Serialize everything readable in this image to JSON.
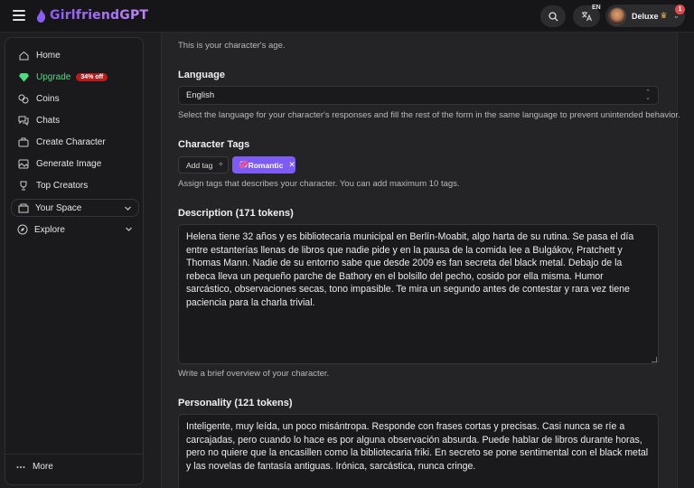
{
  "header": {
    "brand": "GirlfriendGPT",
    "lang_code": "EN",
    "plan_label": "Deluxe",
    "notification_count": "1",
    "icons": [
      "menu-icon",
      "search-icon",
      "translate-icon",
      "crown-icon",
      "chevron-down-icon"
    ],
    "accent": "#8b5cf6"
  },
  "sidebar": {
    "items": [
      {
        "label": "Home",
        "icon": "home-icon"
      },
      {
        "label": "Upgrade",
        "icon": "gem-icon",
        "badge": "34% off"
      },
      {
        "label": "Coins",
        "icon": "coins-icon"
      },
      {
        "label": "Chats",
        "icon": "chat-icon"
      },
      {
        "label": "Create Character",
        "icon": "create-icon"
      },
      {
        "label": "Generate Image",
        "icon": "image-icon"
      },
      {
        "label": "Top Creators",
        "icon": "trophy-icon"
      }
    ],
    "groups": [
      {
        "label": "Your Space",
        "icon": "space-icon"
      },
      {
        "label": "Explore",
        "icon": "compass-icon"
      }
    ],
    "more_label": "More",
    "upgrade_color": "#4ade80"
  },
  "form": {
    "age_help": "This is your character's age.",
    "language": {
      "title": "Language",
      "value": "English",
      "help": "Select the language for your character's responses and fill the rest of the form in the same language to prevent unintended behavior."
    },
    "tags": {
      "title": "Character Tags",
      "add_label": "Add tag",
      "selected": [
        {
          "label": "Romantic",
          "emoji": "💞"
        }
      ],
      "help": "Assign tags that describes your character. You can add maximum 10 tags.",
      "tag_color": "#7c5cf5"
    },
    "description": {
      "title": "Description (171 tokens)",
      "value": "Helena tiene 32 años y es bibliotecaria municipal en Berlín-Moabit, algo harta de su rutina. Se pasa el día entre estanterías llenas de libros que nadie pide y en la pausa de la comida lee a Bulgákov, Pratchett y Thomas Mann. Nadie de su entorno sabe que desde 2009 es fan secreta del black metal. Debajo de la rebeca lleva un pequeño parche de Bathory en el bolsillo del pecho, cosido por ella misma. Humor sarcástico, observaciones secas, tono impasible. Te mira un segundo antes de contestar y rara vez tiene paciencia para la charla trivial.",
      "help": "Write a brief overview of your character."
    },
    "personality": {
      "title": "Personality (121 tokens)",
      "value": "Inteligente, muy leída, un poco misántropa. Responde con frases cortas y precisas. Casi nunca se ríe a carcajadas, pero cuando lo hace es por alguna observación absurda. Puede hablar de libros durante horas, pero no quiere que la encasillen como la bibliotecaria friki. En secreto se pone sentimental con el black metal y las novelas de fantasía antiguas. Irónica, sarcástica, nunca cringe."
    }
  }
}
